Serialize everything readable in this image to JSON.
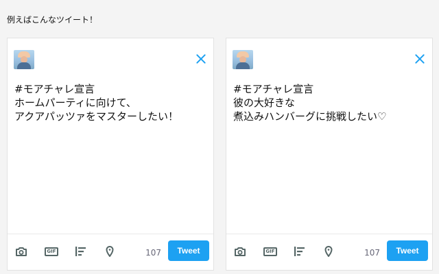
{
  "caption": "例えばこんなツイート！",
  "cards": [
    {
      "lines": [
        "#モアチャレ宣言",
        "ホームパーティに向けて、",
        "アクアパッツァをマスターしたい！"
      ],
      "char_count": "107",
      "tweet_label": "Tweet",
      "icons": [
        "close-icon",
        "camera-icon",
        "gif-icon",
        "poll-icon",
        "location-icon"
      ]
    },
    {
      "lines": [
        "#モアチャレ宣言",
        "彼の大好きな",
        "煮込みハンバーグに挑戦したい♡"
      ],
      "char_count": "107",
      "tweet_label": "Tweet",
      "icons": [
        "close-icon",
        "camera-icon",
        "gif-icon",
        "poll-icon",
        "location-icon"
      ]
    }
  ],
  "colors": {
    "accent": "#1da1f2",
    "icon": "#556666",
    "background": "#f4f4f4"
  }
}
